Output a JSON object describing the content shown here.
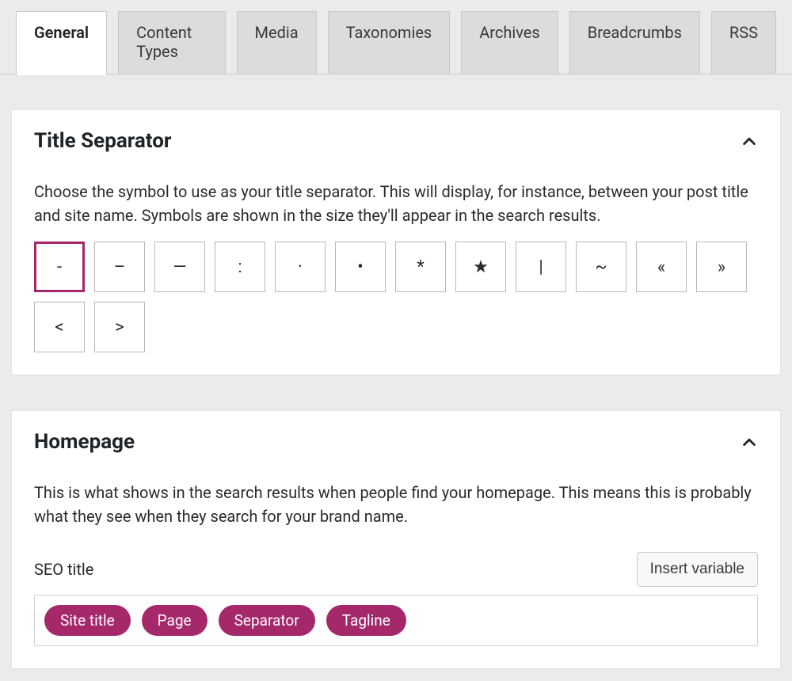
{
  "tabs": {
    "items": [
      {
        "label": "General",
        "active": true
      },
      {
        "label": "Content Types",
        "active": false
      },
      {
        "label": "Media",
        "active": false
      },
      {
        "label": "Taxonomies",
        "active": false
      },
      {
        "label": "Archives",
        "active": false
      },
      {
        "label": "Breadcrumbs",
        "active": false
      },
      {
        "label": "RSS",
        "active": false
      }
    ]
  },
  "title_separator": {
    "heading": "Title Separator",
    "description": "Choose the symbol to use as your title separator. This will display, for instance, between your post title and site name. Symbols are shown in the size they'll appear in the search results.",
    "options": [
      "-",
      "–",
      "—",
      ":",
      "·",
      "•",
      "*",
      "★",
      "|",
      "~",
      "«",
      "»",
      "<",
      ">"
    ],
    "selected_index": 0
  },
  "homepage": {
    "heading": "Homepage",
    "description": "This is what shows in the search results when people find your homepage. This means this is probably what they see when they search for your brand name.",
    "seo_title_label": "SEO title",
    "insert_variable_label": "Insert variable",
    "variables": [
      "Site title",
      "Page",
      "Separator",
      "Tagline"
    ]
  }
}
